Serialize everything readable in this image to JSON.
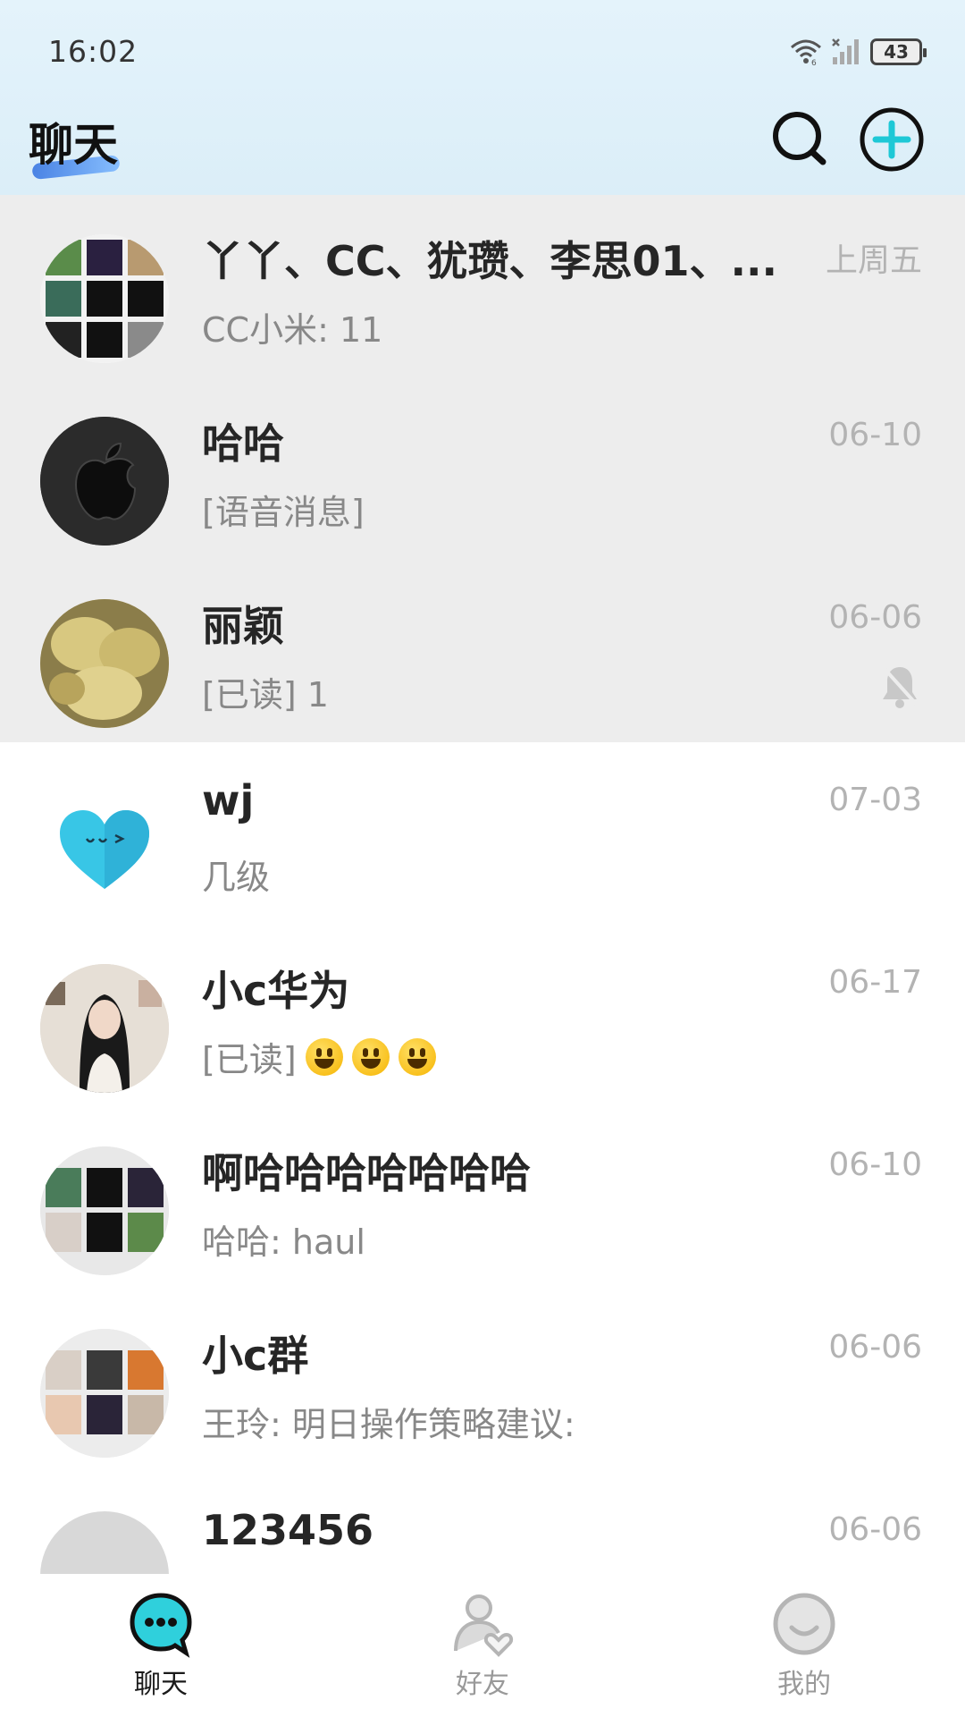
{
  "status_bar": {
    "time": "16:02",
    "battery": "43",
    "icons": [
      "wifi-icon",
      "signal-icon",
      "battery-icon"
    ]
  },
  "header": {
    "title": "聊天",
    "search_icon": "search-icon",
    "add_icon": "plus-circle-icon"
  },
  "chats": [
    {
      "name": "丫丫、CC、犹瓒、李思01、...",
      "time": "上周五",
      "preview": "CC小米: 11",
      "pinned": true,
      "avatar": "group-collage-avatar"
    },
    {
      "name": "哈哈",
      "time": "06-10",
      "preview": "[语音消息]",
      "pinned": true,
      "avatar": "apple-logo-avatar"
    },
    {
      "name": "丽颖",
      "time": "06-06",
      "preview": "[已读] 1",
      "pinned": true,
      "muted": true,
      "avatar": "fruit-avatar"
    },
    {
      "name": "wj",
      "time": "07-03",
      "preview": "几级",
      "pinned": false,
      "avatar": "heart-avatar"
    },
    {
      "name": "小c华为",
      "time": "06-17",
      "preview": "[已读]",
      "emoji_count": 3,
      "pinned": false,
      "avatar": "girl-photo-avatar"
    },
    {
      "name": "啊哈哈哈哈哈哈哈",
      "time": "06-10",
      "preview": "哈哈: haul",
      "pinned": false,
      "avatar": "group-collage-avatar"
    },
    {
      "name": "小c群",
      "time": "06-06",
      "preview": "王玲: 明日操作策略建议:",
      "pinned": false,
      "avatar": "group-collage-avatar"
    },
    {
      "name": "123456",
      "time": "06-06",
      "preview": "",
      "pinned": false,
      "avatar": "default-avatar"
    }
  ],
  "bottom_nav": [
    {
      "label": "聊天",
      "icon": "chat-bubble-icon",
      "active": true
    },
    {
      "label": "好友",
      "icon": "friends-icon",
      "active": false
    },
    {
      "label": "我的",
      "icon": "profile-icon",
      "active": false
    }
  ],
  "colors": {
    "accent": "#2fd0dc",
    "header_bg": "#dff0fa",
    "pinned_bg": "#ededed",
    "time_text": "#b3b3b3",
    "preview_text": "#888888"
  }
}
